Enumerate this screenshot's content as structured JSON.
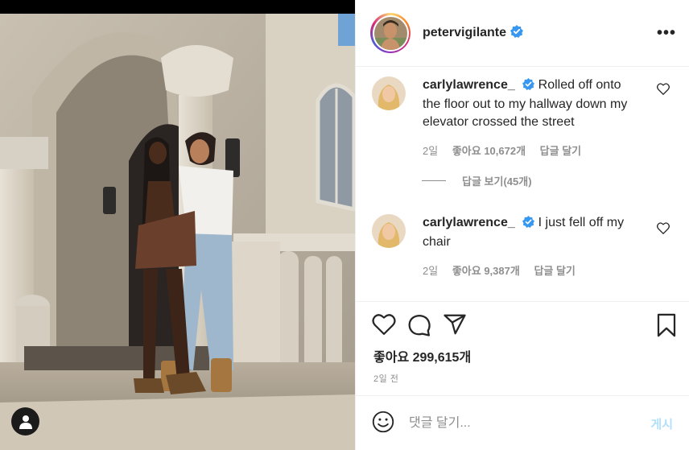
{
  "post": {
    "author": {
      "username": "petervigilante",
      "verified": true
    },
    "more_icon": "more-horizontal-icon"
  },
  "comments": [
    {
      "username": "carlylawrence_",
      "verified": true,
      "text": "Rolled off onto the floor out to my hallway down my elevator crossed the street",
      "time": "2일",
      "likes": "좋아요 10,672개",
      "reply": "답글 달기"
    },
    {
      "username": "carlylawrence_",
      "verified": true,
      "text": "I just fell off my chair",
      "time": "2일",
      "likes": "좋아요 9,387개",
      "reply": "답글 달기"
    }
  ],
  "view_replies": "답글 보기(45개)",
  "actions": {
    "likes": "좋아요 299,615개",
    "date": "2일 전",
    "icons": [
      "heart-icon",
      "comment-icon",
      "share-icon",
      "bookmark-icon"
    ]
  },
  "add_comment": {
    "placeholder": "댓글 달기...",
    "post_label": "게시",
    "emoji_icon": "emoji-icon"
  },
  "colors": {
    "text": "#262626",
    "muted": "#8e8e8e",
    "verified": "#3897f0",
    "post_disabled": "#b2dffc"
  }
}
